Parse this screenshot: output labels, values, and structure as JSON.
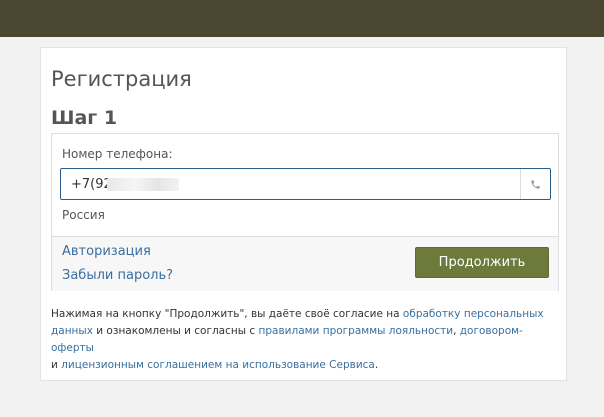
{
  "header": {
    "bar_color": "#4a4632"
  },
  "form": {
    "title": "Регистрация",
    "step": "Шаг 1",
    "phone_label": "Номер телефона:",
    "phone_value": "+7(92",
    "phone_icon": "phone-icon",
    "country": "Россия",
    "auth_link": "Авторизация",
    "forgot_link": "Забыли пароль?",
    "continue_button": "Продолжить",
    "accent_color": "#6d7a3c"
  },
  "consent": {
    "text_1": "Нажимая на кнопку \"Продолжить\", вы даёте своё согласие на ",
    "link_1": "обработку персональных данных",
    "text_2": " и ознакомлены и согласны с ",
    "link_2": "правилами программы лояльности",
    "text_3": ", ",
    "link_3": "договором-оферты",
    "text_4": " и ",
    "link_4": "лицензионным соглашением",
    "text_5": " ",
    "link_5": "на использование Сервиса",
    "text_6": "."
  }
}
